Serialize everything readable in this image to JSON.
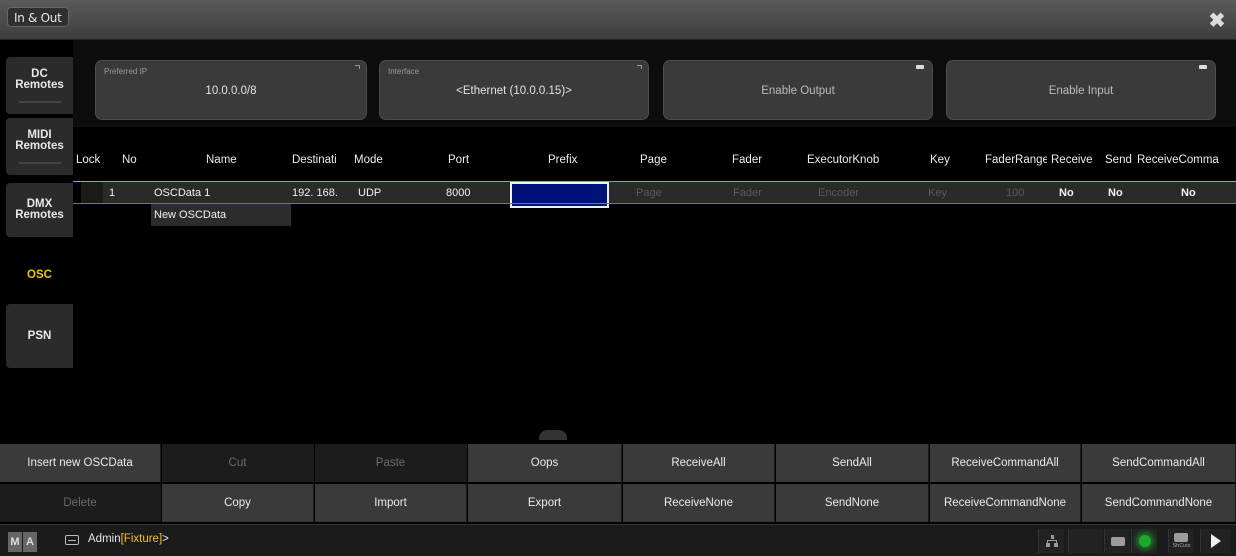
{
  "window": {
    "title": "In & Out",
    "close_icon": "close-icon"
  },
  "sidebar": {
    "items": [
      {
        "label": "DC\nRemotes"
      },
      {
        "label": "MIDI\nRemotes"
      },
      {
        "label": "DMX\nRemotes"
      },
      {
        "label": "OSC"
      },
      {
        "label": "PSN"
      }
    ],
    "active": "OSC",
    "active_color": "#f4c21c"
  },
  "config": {
    "preferred_ip": {
      "caption": "Preferred IP",
      "value": "10.0.0.0/8"
    },
    "interface": {
      "caption": "Interface",
      "value": "<Ethernet (10.0.0.15)>"
    },
    "enable_output": {
      "label": "Enable Output"
    },
    "enable_input": {
      "label": "Enable Input"
    }
  },
  "table": {
    "columns": [
      "Lock",
      "No",
      "Name",
      "Destinati",
      "Mode",
      "Port",
      "Prefix",
      "Page",
      "Fader",
      "ExecutorKnob",
      "Key",
      "FaderRange",
      "Receive",
      "Send",
      "ReceiveComma"
    ],
    "rows": [
      {
        "lock": "",
        "no": "1",
        "name": "OSCData 1",
        "destination": "192. 168.",
        "mode": "UDP",
        "port": "8000",
        "prefix": "",
        "page": "Page",
        "fader": "Fader",
        "executor_knob": "Encoder",
        "key": "Key",
        "fader_range": "100",
        "receive": "No",
        "send": "No",
        "receive_command": "No"
      }
    ],
    "new_row_label": "New OSCData",
    "header_accent": "#c9a227",
    "selection_color": "#00117a"
  },
  "toolbar": {
    "row1": [
      "Insert new OSCData",
      "Cut",
      "Paste",
      "Oops",
      "ReceiveAll",
      "SendAll",
      "ReceiveCommandAll",
      "SendCommandAll"
    ],
    "row2": [
      "Delete",
      "Copy",
      "Import",
      "Export",
      "ReceiveNone",
      "SendNone",
      "ReceiveCommandNone",
      "SendCommandNone"
    ]
  },
  "statusbar": {
    "logo": [
      "M",
      "A"
    ],
    "command_prefix": "Admin",
    "command_context": "[Fixture]",
    "command_suffix": ">",
    "shortcuts_label": "ShCuts"
  }
}
